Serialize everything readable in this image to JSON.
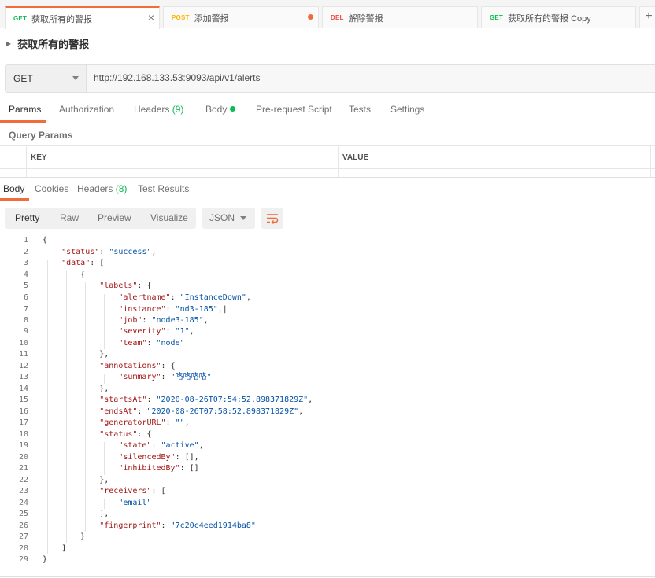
{
  "request_tabs": [
    {
      "method": "GET",
      "name": "获取所有的警报",
      "active": true
    },
    {
      "method": "POST",
      "name": "添加警报"
    },
    {
      "method": "DEL",
      "name": "解除警报"
    },
    {
      "method": "GET",
      "name": "获取所有的警报 Copy"
    }
  ],
  "request": {
    "name": "获取所有的警报",
    "method": "GET",
    "url": "http://192.168.133.53:9093/api/v1/alerts"
  },
  "request_subtabs": {
    "params": "Params",
    "authorization": "Authorization",
    "headers": "Headers",
    "headers_count": "(9)",
    "body": "Body",
    "pre_request": "Pre-request Script",
    "tests": "Tests",
    "settings": "Settings"
  },
  "query_params": {
    "title": "Query Params",
    "col_key": "KEY",
    "col_value": "VALUE"
  },
  "response_tabs": {
    "body": "Body",
    "cookies": "Cookies",
    "headers": "Headers",
    "headers_count": "(8)",
    "test_results": "Test Results"
  },
  "view_modes": {
    "pretty": "Pretty",
    "raw": "Raw",
    "preview": "Preview",
    "visualize": "Visualize",
    "format": "JSON"
  },
  "colors": {
    "accent": "#f26b3a",
    "get": "#0cbb52",
    "post": "#ffb400",
    "del": "#ed4b48",
    "json_key": "#a31515",
    "json_string": "#0451a5"
  },
  "code_lines": [
    [
      [
        "{",
        "p"
      ]
    ],
    [
      [
        "    ",
        "p"
      ],
      [
        "\"status\"",
        "k"
      ],
      [
        ": ",
        "p"
      ],
      [
        "\"success\"",
        "s"
      ],
      [
        ",",
        "p"
      ]
    ],
    [
      [
        "    ",
        "p"
      ],
      [
        "\"data\"",
        "k"
      ],
      [
        ": [",
        "p"
      ]
    ],
    [
      [
        "        {",
        "p"
      ]
    ],
    [
      [
        "            ",
        "p"
      ],
      [
        "\"labels\"",
        "k"
      ],
      [
        ": {",
        "p"
      ]
    ],
    [
      [
        "                ",
        "p"
      ],
      [
        "\"alertname\"",
        "k"
      ],
      [
        ": ",
        "p"
      ],
      [
        "\"InstanceDown\"",
        "s"
      ],
      [
        ",",
        "p"
      ]
    ],
    [
      [
        "                ",
        "p"
      ],
      [
        "\"instance\"",
        "k"
      ],
      [
        ": ",
        "p"
      ],
      [
        "\"nd3-185\"",
        "s"
      ],
      [
        ",|",
        "p"
      ]
    ],
    [
      [
        "                ",
        "p"
      ],
      [
        "\"job\"",
        "k"
      ],
      [
        ": ",
        "p"
      ],
      [
        "\"node3-185\"",
        "s"
      ],
      [
        ",",
        "p"
      ]
    ],
    [
      [
        "                ",
        "p"
      ],
      [
        "\"severity\"",
        "k"
      ],
      [
        ": ",
        "p"
      ],
      [
        "\"1\"",
        "s"
      ],
      [
        ",",
        "p"
      ]
    ],
    [
      [
        "                ",
        "p"
      ],
      [
        "\"team\"",
        "k"
      ],
      [
        ": ",
        "p"
      ],
      [
        "\"node\"",
        "s"
      ]
    ],
    [
      [
        "            },",
        "p"
      ]
    ],
    [
      [
        "            ",
        "p"
      ],
      [
        "\"annotations\"",
        "k"
      ],
      [
        ": {",
        "p"
      ]
    ],
    [
      [
        "                ",
        "p"
      ],
      [
        "\"summary\"",
        "k"
      ],
      [
        ": ",
        "p"
      ],
      [
        "\"咯咯咯咯\"",
        "s"
      ]
    ],
    [
      [
        "            },",
        "p"
      ]
    ],
    [
      [
        "            ",
        "p"
      ],
      [
        "\"startsAt\"",
        "k"
      ],
      [
        ": ",
        "p"
      ],
      [
        "\"2020-08-26T07:54:52.898371829Z\"",
        "s"
      ],
      [
        ",",
        "p"
      ]
    ],
    [
      [
        "            ",
        "p"
      ],
      [
        "\"endsAt\"",
        "k"
      ],
      [
        ": ",
        "p"
      ],
      [
        "\"2020-08-26T07:58:52.898371829Z\"",
        "s"
      ],
      [
        ",",
        "p"
      ]
    ],
    [
      [
        "            ",
        "p"
      ],
      [
        "\"generatorURL\"",
        "k"
      ],
      [
        ": ",
        "p"
      ],
      [
        "\"\"",
        "s"
      ],
      [
        ",",
        "p"
      ]
    ],
    [
      [
        "            ",
        "p"
      ],
      [
        "\"status\"",
        "k"
      ],
      [
        ": {",
        "p"
      ]
    ],
    [
      [
        "                ",
        "p"
      ],
      [
        "\"state\"",
        "k"
      ],
      [
        ": ",
        "p"
      ],
      [
        "\"active\"",
        "s"
      ],
      [
        ",",
        "p"
      ]
    ],
    [
      [
        "                ",
        "p"
      ],
      [
        "\"silencedBy\"",
        "k"
      ],
      [
        ": [],",
        "p"
      ]
    ],
    [
      [
        "                ",
        "p"
      ],
      [
        "\"inhibitedBy\"",
        "k"
      ],
      [
        ": []",
        "p"
      ]
    ],
    [
      [
        "            },",
        "p"
      ]
    ],
    [
      [
        "            ",
        "p"
      ],
      [
        "\"receivers\"",
        "k"
      ],
      [
        ": [",
        "p"
      ]
    ],
    [
      [
        "                ",
        "p"
      ],
      [
        "\"email\"",
        "s"
      ]
    ],
    [
      [
        "            ],",
        "p"
      ]
    ],
    [
      [
        "            ",
        "p"
      ],
      [
        "\"fingerprint\"",
        "k"
      ],
      [
        ": ",
        "p"
      ],
      [
        "\"7c20c4eed1914ba8\"",
        "s"
      ]
    ],
    [
      [
        "        }",
        "p"
      ]
    ],
    [
      [
        "    ]",
        "p"
      ]
    ],
    [
      [
        "}",
        "p"
      ]
    ]
  ]
}
